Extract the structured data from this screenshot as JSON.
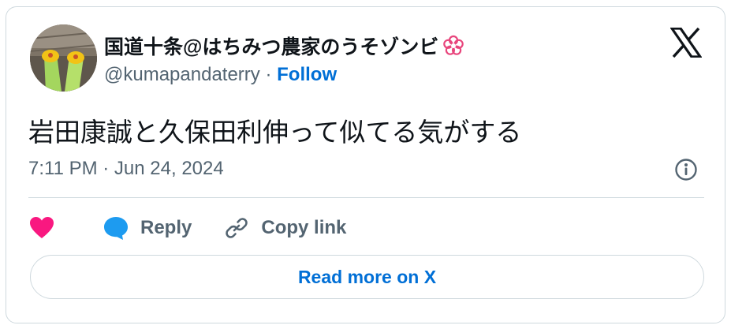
{
  "author": {
    "display_name": "国道十条@はちみつ農家のうそゾンビ",
    "handle": "@kumapandaterry",
    "separator": " · ",
    "follow_label": "Follow"
  },
  "tweet": {
    "text": "岩田康誠と久保田利伸って似てる気がする",
    "timestamp": "7:11 PM · Jun 24, 2024"
  },
  "actions": {
    "reply_label": "Reply",
    "copy_link_label": "Copy link"
  },
  "cta": {
    "read_more_label": "Read more on X"
  },
  "colors": {
    "like": "#f91880",
    "reply": "#1d9bf0",
    "link": "#006fd6",
    "muted": "#536471",
    "badge": "#e8457c"
  },
  "icons": [
    "avatar",
    "flower-badge-icon",
    "x-logo-icon",
    "info-icon",
    "heart-icon",
    "reply-bubble-icon",
    "link-icon"
  ]
}
